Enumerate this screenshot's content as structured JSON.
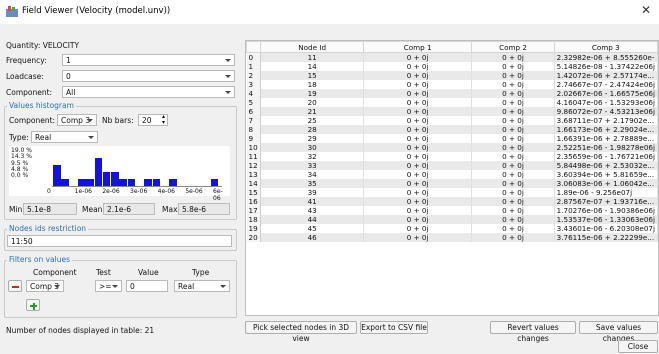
{
  "window": {
    "title": "Field Viewer (Velocity (model.unv))",
    "close_glyph": "✕"
  },
  "left": {
    "quantity_label": "Quantity: VELOCITY",
    "frequency_label": "Frequency:",
    "frequency_value": "1",
    "loadcase_label": "Loadcase:",
    "loadcase_value": "0",
    "component_label": "Component:",
    "component_value": "All"
  },
  "histogram": {
    "group_title": "Values histogram",
    "component_label": "Component:",
    "component_value": "Comp 3",
    "nb_bars_label": "Nb bars:",
    "nb_bars_value": "20",
    "type_label": "Type:",
    "type_value": "Real",
    "y_ticks": [
      "19.0 %",
      "14.3 %",
      "9.5 %",
      "4.8 %",
      "0.0 %"
    ],
    "x_ticks": [
      "0",
      "1e-06",
      "2e-06",
      "3e-06",
      "4e-06",
      "5e-06",
      "6e-06"
    ],
    "bar_percents": [
      14.3,
      4.8,
      0,
      4.8,
      4.8,
      19.0,
      9.5,
      9.5,
      4.8,
      4.8,
      0,
      4.8,
      4.8,
      0,
      4.8,
      0,
      0,
      0,
      0,
      4.8
    ],
    "min_label": "Min",
    "min_value": "5.1e-8",
    "mean_label": "Mean",
    "mean_value": "2.1e-6",
    "max_label": "Max",
    "max_value": "5.8e-6",
    "bar_color": "#1414d8"
  },
  "restriction": {
    "group_title": "Nodes ids restriction",
    "value": "11:50"
  },
  "filters": {
    "group_title": "Filters on values",
    "headers": [
      "Component",
      "Test",
      "Value",
      "Type"
    ],
    "component": "Comp 3",
    "test": ">=",
    "value": "0",
    "type": "Real",
    "remove_icon": "minus-icon",
    "add_icon": "plus-icon"
  },
  "footer": {
    "nodes_count_text": "Number of nodes displayed in table:  21",
    "pick_button": "Pick selected nodes in 3D view",
    "export_button": "Export to CSV file",
    "revert_button": "Revert values changes",
    "save_button": "Save values changes",
    "close_button": "Close"
  },
  "table": {
    "headers": [
      "Node Id",
      "Comp 1",
      "Comp 2",
      "Comp 3"
    ],
    "rows": [
      [
        "0",
        "11",
        "0 +  0j",
        "0 +  0j",
        "2.32982e-06 + 8.555260e-"
      ],
      [
        "1",
        "14",
        "0 +  0j",
        "0 +  0j",
        "5.14826e-08 - 1.37422e06j"
      ],
      [
        "2",
        "15",
        "0 +  0j",
        "0 +  0j",
        "1.42072e-06 + 2.57174e..."
      ],
      [
        "3",
        "18",
        "0 +  0j",
        "0 +  0j",
        "2.74667e-07 - 2.47424e06j"
      ],
      [
        "4",
        "19",
        "0 +  0j",
        "0 +  0j",
        "2.02667e-06 - 1.66575e06j"
      ],
      [
        "5",
        "20",
        "0 +  0j",
        "0 +  0j",
        "4.16047e-06 - 1.53293e06j"
      ],
      [
        "6",
        "21",
        "0 +  0j",
        "0 +  0j",
        "9.86072e-07 - 4.53213e06j"
      ],
      [
        "7",
        "25",
        "0 +  0j",
        "0 +  0j",
        "3.68711e-07 + 2.17902e..."
      ],
      [
        "8",
        "28",
        "0 +  0j",
        "0 +  0j",
        "1.66173e-06 + 2.29024e..."
      ],
      [
        "9",
        "29",
        "0 +  0j",
        "0 +  0j",
        "1.66391e-06 + 2.78889e..."
      ],
      [
        "10",
        "30",
        "0 +  0j",
        "0 +  0j",
        "2.52251e-06 - 1.98278e06j"
      ],
      [
        "11",
        "32",
        "0 +  0j",
        "0 +  0j",
        "2.35659e-06 - 1.76721e06j"
      ],
      [
        "12",
        "33",
        "0 +  0j",
        "0 +  0j",
        "5.84498e-06 + 2.53032e..."
      ],
      [
        "13",
        "34",
        "0 +  0j",
        "0 +  0j",
        "3.60394e-06 + 5.81659e..."
      ],
      [
        "14",
        "35",
        "0 +  0j",
        "0 +  0j",
        "3.06083e-06 + 1.06042e..."
      ],
      [
        "15",
        "39",
        "0 +  0j",
        "0 +  0j",
        "1.89e-06 - 9.256e07j"
      ],
      [
        "16",
        "41",
        "0 +  0j",
        "0 +  0j",
        "2.87567e-07 + 1.93716e..."
      ],
      [
        "17",
        "43",
        "0 +  0j",
        "0 +  0j",
        "1.70276e-06 - 1.90386e06j"
      ],
      [
        "18",
        "44",
        "0 +  0j",
        "0 +  0j",
        "1.53537e-06 - 1.33063e06j"
      ],
      [
        "19",
        "45",
        "0 +  0j",
        "0 +  0j",
        "3.43601e-06 - 6.20308e07j"
      ],
      [
        "20",
        "46",
        "0 +  0j",
        "0 +  0j",
        "3.76115e-06 + 2.22299e..."
      ]
    ]
  }
}
